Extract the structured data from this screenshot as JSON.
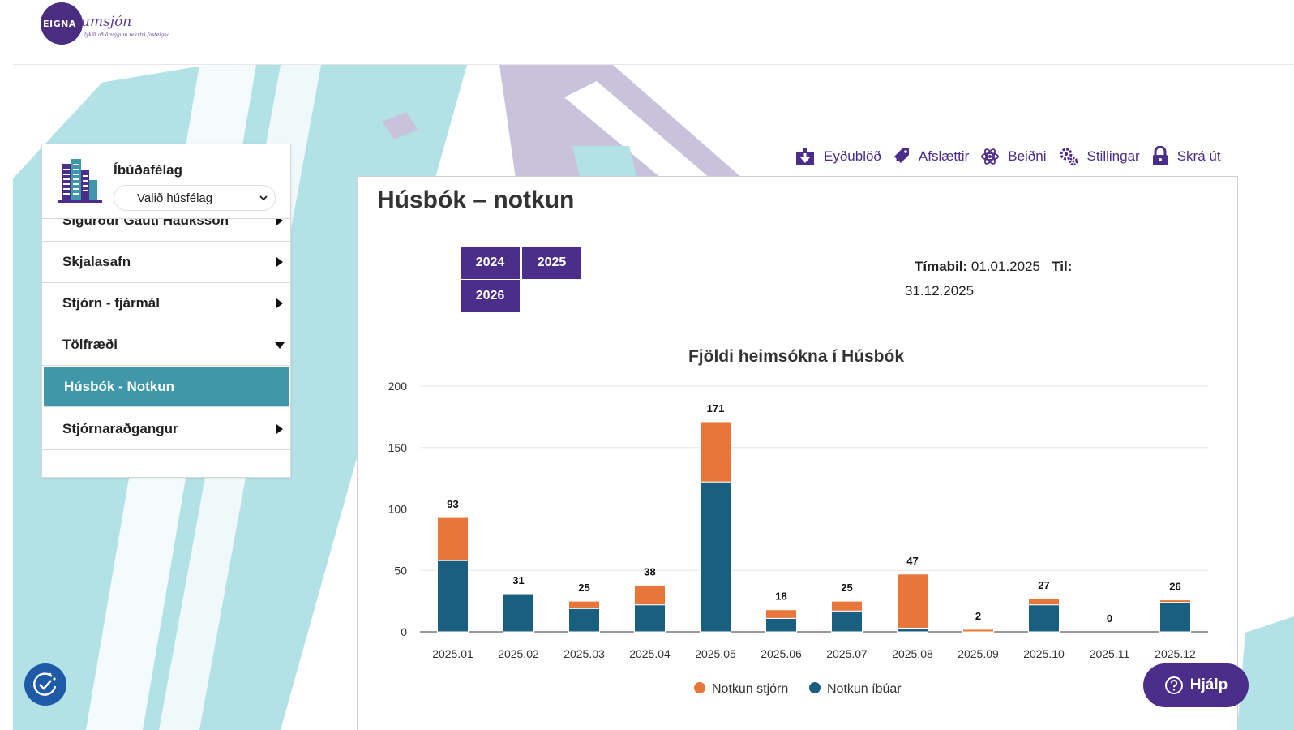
{
  "header": {
    "logo_eigna": "EIGNA",
    "logo_umsjon": "umsjón",
    "logo_tagline": "lykill að öruggum rekstri fasteigna"
  },
  "sidebar": {
    "association_label": "Íbúðafélag",
    "association_select": "Valið húsfélag",
    "items": [
      {
        "label": "Sigurður Gauti Hauksson",
        "state": "collapsed"
      },
      {
        "label": "Skjalasafn",
        "state": "collapsed"
      },
      {
        "label": "Stjórn - fjármál",
        "state": "collapsed"
      },
      {
        "label": "Tölfræði",
        "state": "expanded"
      },
      {
        "label": "Húsbók - Notkun",
        "state": "active"
      },
      {
        "label": "Stjórnaraðgangur",
        "state": "collapsed"
      }
    ]
  },
  "topnav": {
    "items": [
      {
        "label": "Eyðublöð",
        "icon": "download-box-icon"
      },
      {
        "label": "Afslættir",
        "icon": "tag-icon"
      },
      {
        "label": "Beiðni",
        "icon": "atom-icon"
      },
      {
        "label": "Stillingar",
        "icon": "gears-icon"
      },
      {
        "label": "Skrá út",
        "icon": "lock-icon"
      }
    ]
  },
  "main": {
    "title": "Húsbók – notkun",
    "years": [
      "2024",
      "2025",
      "2026"
    ],
    "period_label": "Tímabil:",
    "period_from": "01.01.2025",
    "period_to_label": "Til:",
    "period_to": "31.12.2025"
  },
  "chart_data": {
    "type": "bar",
    "stacked": true,
    "title": "Fjöldi heimsókna í Húsbók",
    "categories": [
      "2025.01",
      "2025.02",
      "2025.03",
      "2025.04",
      "2025.05",
      "2025.06",
      "2025.07",
      "2025.08",
      "2025.09",
      "2025.10",
      "2025.11",
      "2025.12"
    ],
    "series": [
      {
        "name": "Notkun íbúar",
        "color": "#1a5f80",
        "values": [
          58,
          31,
          19,
          22,
          122,
          11,
          17,
          3,
          0,
          22,
          0,
          24
        ]
      },
      {
        "name": "Notkun stjórn",
        "color": "#e8753a",
        "values": [
          35,
          0,
          6,
          16,
          49,
          7,
          8,
          44,
          2,
          5,
          0,
          2
        ]
      }
    ],
    "totals": [
      93,
      31,
      25,
      38,
      171,
      18,
      25,
      47,
      2,
      27,
      0,
      26
    ],
    "yticks": [
      0,
      50,
      100,
      150,
      200
    ],
    "ylim": [
      0,
      200
    ],
    "grid": true,
    "legend": "bottom"
  },
  "buttons": {
    "help": "Hjálp"
  }
}
